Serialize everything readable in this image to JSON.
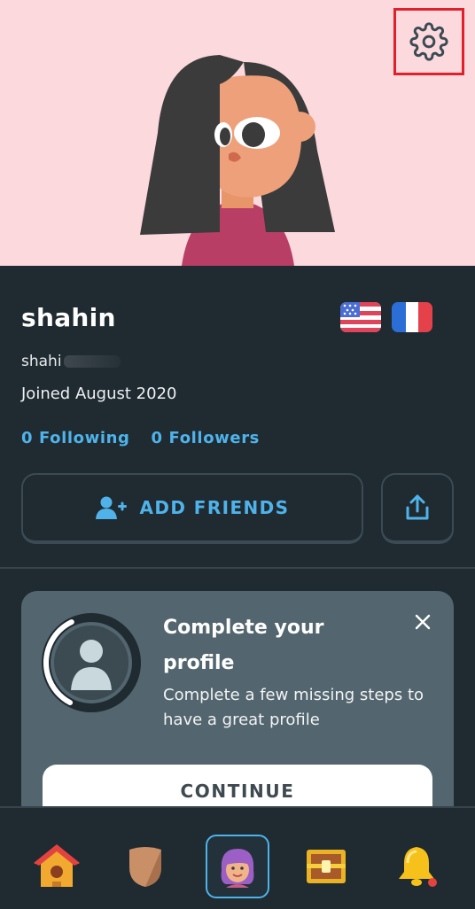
{
  "profile": {
    "name": "shahin",
    "username": "shahi",
    "joined": "Joined August 2020",
    "following": "0 Following",
    "followers": "0 Followers",
    "flags": [
      "us-flag",
      "fr-flag"
    ]
  },
  "actions": {
    "add_friends": "ADD FRIENDS",
    "share_icon": "share-icon",
    "add_friend_icon": "add-person-icon",
    "settings_icon": "gear-icon"
  },
  "card": {
    "title": "Complete your profile",
    "description": "Complete a few missing steps to have a great profile",
    "continue_label": "CONTINUE",
    "progress": 0.35,
    "close_icon": "close-icon"
  },
  "nav": {
    "items": [
      {
        "icon": "home-icon",
        "active": false
      },
      {
        "icon": "shield-icon",
        "active": false
      },
      {
        "icon": "profile-icon",
        "active": true
      },
      {
        "icon": "treasure-chest-icon",
        "active": false
      },
      {
        "icon": "bell-icon",
        "active": false
      }
    ]
  },
  "colors": {
    "background": "#1f2a31",
    "hero": "#fbd9dd",
    "accent_blue": "#4fb3ea",
    "card": "#53656e",
    "highlight": "#e0202a"
  }
}
